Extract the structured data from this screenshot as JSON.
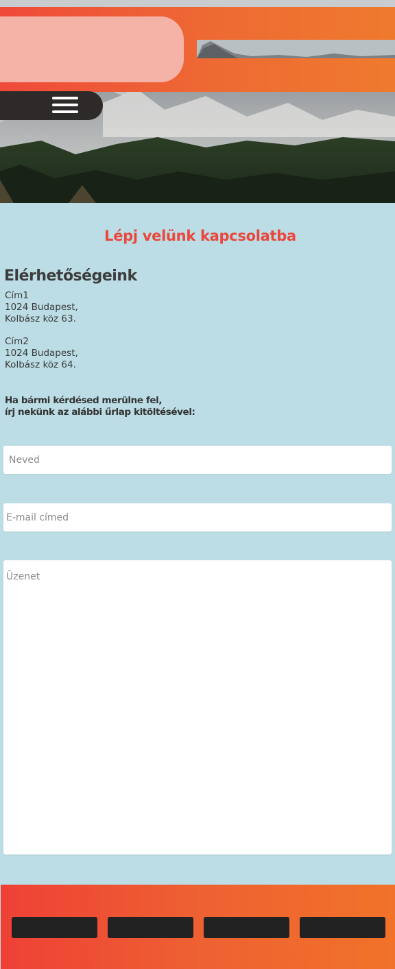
{
  "header": {
    "menu_icon": "hamburger-menu-icon",
    "colors": {
      "band_start": "#ef4a3a",
      "band_end": "#ef7a2e",
      "logo_pill": "#f5b3a8",
      "menu_bar": "#2e2a2a"
    }
  },
  "main": {
    "title": "Lépj velünk kapcsolatba",
    "contact_heading": "Elérhetőségeink",
    "address1": {
      "name": "Cím1",
      "line1": "1024 Budapest,",
      "line2": "Kolbász köz 63."
    },
    "address2": {
      "name": "Cím2",
      "line1": "1024 Budapest,",
      "line2": "Kolbász köz 64."
    },
    "prompt_line1": "Ha bármi kérdésed merülne fel,",
    "prompt_line2": "írj nekünk az alábbi űrlap kitöltésével:"
  },
  "form": {
    "name_placeholder": "Neved",
    "email_placeholder": "E-mail címed",
    "message_placeholder": "Üzenet"
  },
  "colors": {
    "background": "#bcdde5",
    "accent": "#e9473c",
    "footer_button": "#222222"
  }
}
